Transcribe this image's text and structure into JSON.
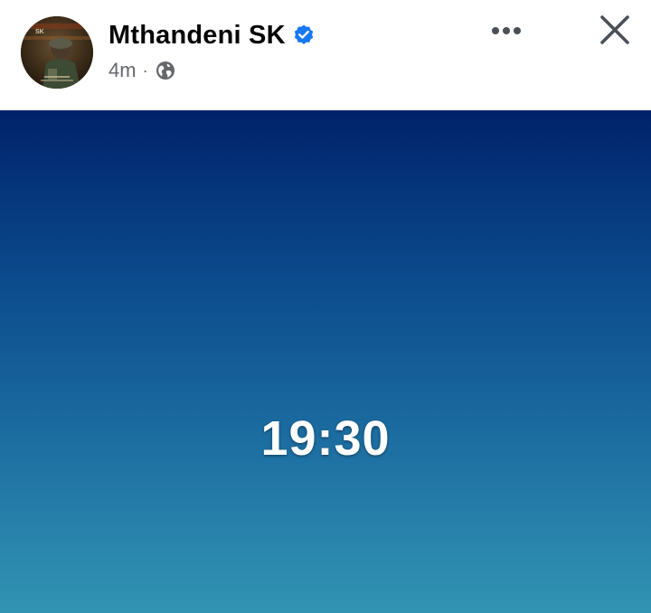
{
  "post": {
    "author_name": "Mthandeni SK",
    "verified": true,
    "time_ago": "4m",
    "separator": "·",
    "audience_icon": "globe-icon",
    "text": "19:30",
    "background_colors": [
      "#00226b",
      "#0b4a8c",
      "#1d6fa2",
      "#3294b3"
    ]
  },
  "header": {
    "more_icon": "more-horizontal-icon",
    "close_icon": "close-icon"
  },
  "avatar": {
    "logo_text": "SK"
  },
  "colors": {
    "verified_blue": "#1877f2",
    "name_text": "#050505",
    "meta_text": "#65676b",
    "icon_gray": "#4b4f56"
  }
}
